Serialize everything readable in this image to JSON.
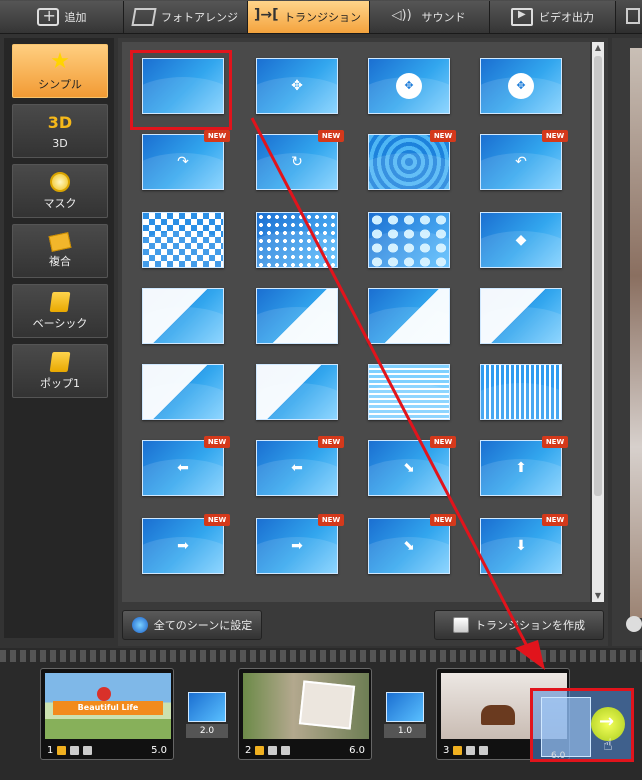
{
  "tabs": [
    {
      "label": "追加",
      "icon": "add-icon",
      "active": false
    },
    {
      "label": "フォトアレンジ",
      "icon": "photo-arrange-icon",
      "active": false
    },
    {
      "label": "トランジション",
      "icon": "transition-icon",
      "active": true
    },
    {
      "label": "サウンド",
      "icon": "sound-icon",
      "active": false
    },
    {
      "label": "ビデオ出力",
      "icon": "video-output-icon",
      "active": false
    }
  ],
  "categories": [
    {
      "label": "シンプル",
      "icon": "star-icon",
      "active": true
    },
    {
      "label": "3D",
      "icon_text": "3D",
      "active": false
    },
    {
      "label": "マスク",
      "icon": "mask-icon",
      "active": false
    },
    {
      "label": "複合",
      "icon": "combo-icon",
      "active": false
    },
    {
      "label": "ベーシック",
      "icon": "scroll-icon",
      "active": false
    },
    {
      "label": "ポップ1",
      "icon": "scroll-icon",
      "active": false
    }
  ],
  "grid": {
    "new_badge": "NEW",
    "thumbs": [
      {
        "style": "plain",
        "new": false,
        "selected": true
      },
      {
        "style": "center-arrows",
        "new": false
      },
      {
        "style": "circle",
        "new": false
      },
      {
        "style": "circle",
        "new": false
      },
      {
        "style": "page-curl",
        "new": true
      },
      {
        "style": "split-cross",
        "new": true
      },
      {
        "style": "rings",
        "new": true
      },
      {
        "style": "page-curl-back",
        "new": true
      },
      {
        "style": "checker",
        "new": false
      },
      {
        "style": "dots",
        "new": false
      },
      {
        "style": "hex",
        "new": false
      },
      {
        "style": "diamond",
        "new": false
      },
      {
        "style": "wipe-diag",
        "new": false
      },
      {
        "style": "wipe-diag2",
        "new": false
      },
      {
        "style": "wipe-diag2",
        "new": false
      },
      {
        "style": "wipe-diag",
        "new": false
      },
      {
        "style": "wipe-diag",
        "new": false
      },
      {
        "style": "wipe-diag",
        "new": false
      },
      {
        "style": "stripes-h",
        "new": false
      },
      {
        "style": "stripes-v",
        "new": false
      },
      {
        "style": "arrow-left",
        "new": true
      },
      {
        "style": "arrow-left",
        "new": true
      },
      {
        "style": "arrow-down-right",
        "new": true
      },
      {
        "style": "arrow-up",
        "new": true
      },
      {
        "style": "arrow-right",
        "new": true
      },
      {
        "style": "arrow-right",
        "new": true
      },
      {
        "style": "arrow-down-right",
        "new": true
      },
      {
        "style": "arrow-down",
        "new": true
      }
    ]
  },
  "buttons": {
    "apply_all": "全てのシーンに設定",
    "create_transition": "トランジションを作成"
  },
  "timeline": {
    "clips": [
      {
        "index": "1",
        "duration": "5.0",
        "banner": "Beautiful Life"
      },
      {
        "index": "2",
        "duration": "6.0"
      },
      {
        "index": "3",
        "duration": "6.0"
      }
    ],
    "transitions": [
      "2.0",
      "1.0"
    ]
  },
  "colors": {
    "accent_orange": "#f4a33d",
    "highlight_red": "#e1141c",
    "thumb_blue": "#2a8fe6"
  }
}
